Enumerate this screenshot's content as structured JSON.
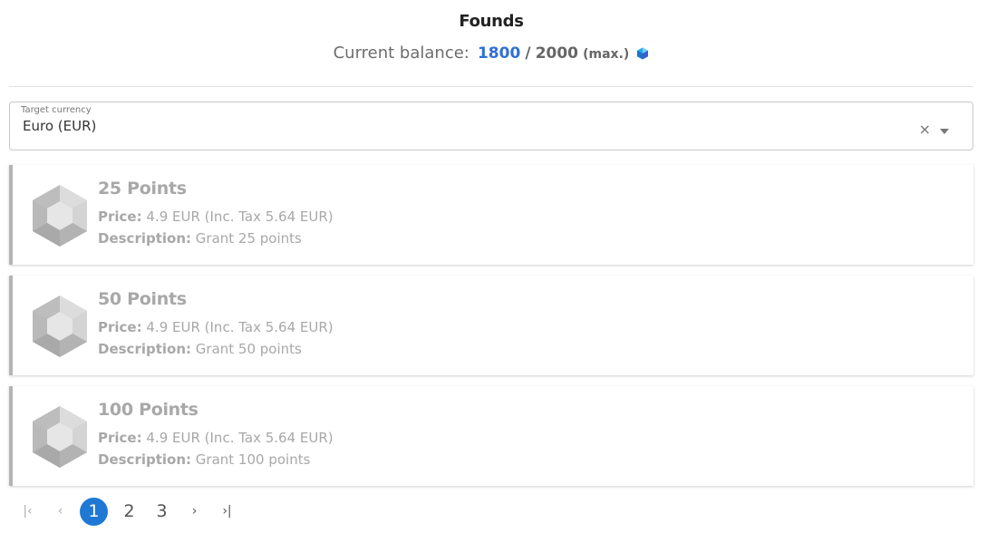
{
  "title": "Founds",
  "balance": {
    "label": "Current balance:",
    "current": "1800",
    "separator": "/",
    "max": "2000",
    "max_label": "(max.)",
    "icon": "gem-icon"
  },
  "currency_select": {
    "label": "Target currency",
    "value": "Euro (EUR)",
    "clear_icon": "×"
  },
  "packages": [
    {
      "name": "25 Points",
      "price_label": "Price:",
      "price": "4.9 EUR (Inc. Tax 5.64 EUR)",
      "description_label": "Description:",
      "description": "Grant 25 points"
    },
    {
      "name": "50 Points",
      "price_label": "Price:",
      "price": "4.9 EUR (Inc. Tax 5.64 EUR)",
      "description_label": "Description:",
      "description": "Grant 50 points"
    },
    {
      "name": "100 Points",
      "price_label": "Price:",
      "price": "4.9 EUR (Inc. Tax 5.64 EUR)",
      "description_label": "Description:",
      "description": "Grant 100 points"
    }
  ],
  "pagination": {
    "first_icon": "|‹",
    "prev_icon": "‹",
    "pages": [
      "1",
      "2",
      "3"
    ],
    "active_page": "1",
    "next_icon": "›",
    "last_icon": "›|"
  },
  "colors": {
    "accent": "#1f79d4",
    "balance_current": "#2f6fd6",
    "card_border": "#b4b4b4"
  }
}
